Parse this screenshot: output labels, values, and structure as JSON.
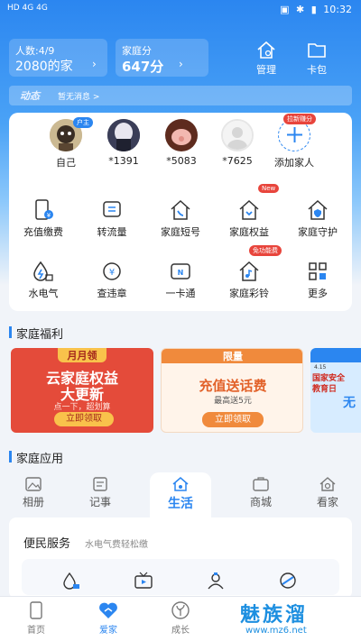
{
  "status_bar": {
    "left": "HD 4G 4G",
    "time": "10:32"
  },
  "header": {
    "members_card": {
      "title": "人数:4/9",
      "value": "2080的家"
    },
    "score_card": {
      "title": "家庭分",
      "value": "647分"
    },
    "manage_label": "管理",
    "wallet_label": "卡包"
  },
  "news": {
    "tag": "动态",
    "message": "暂无消息 >"
  },
  "members": [
    {
      "label": "自己",
      "badge": "户主"
    },
    {
      "label": "*1391"
    },
    {
      "label": "*5083"
    },
    {
      "label": "*7625"
    },
    {
      "label": "添加家人",
      "badge": "拉新赚分"
    }
  ],
  "grid": [
    {
      "label": "充值缴费",
      "icon": "phone-pay-icon"
    },
    {
      "label": "转流量",
      "icon": "data-transfer-icon"
    },
    {
      "label": "家庭短号",
      "icon": "home-phone-icon"
    },
    {
      "label": "家庭权益",
      "icon": "home-benefit-icon",
      "badge": "New"
    },
    {
      "label": "家庭守护",
      "icon": "home-shield-icon"
    },
    {
      "label": "水电气",
      "icon": "utilities-icon"
    },
    {
      "label": "查违章",
      "icon": "traffic-violation-icon"
    },
    {
      "label": "一卡通",
      "icon": "card-icon"
    },
    {
      "label": "家庭彩铃",
      "icon": "ringtone-icon",
      "badge": "免功能费"
    },
    {
      "label": "更多",
      "icon": "more-icon"
    }
  ],
  "welfare": {
    "title": "家庭福利",
    "banner1": {
      "tag": "月月领",
      "line1": "云家庭权益",
      "line2": "大更新",
      "sub": "点一下，超划算",
      "button": "立即领取"
    },
    "banner2": {
      "tag": "限量",
      "line1": "充值送话费",
      "sub": "最高送5元",
      "button": "立即领取"
    },
    "banner3": {
      "date": "4.15",
      "line1": "国家安全",
      "line2": "教育日",
      "line3": "无"
    }
  },
  "apps": {
    "title": "家庭应用",
    "tabs": [
      "相册",
      "记事",
      "生活",
      "商城",
      "看家"
    ],
    "active_tab": "生活"
  },
  "service": {
    "title": "便民服务",
    "subtitle": "水电气费轻松缴"
  },
  "bottom_nav": [
    {
      "label": "首页"
    },
    {
      "label": "爱家"
    },
    {
      "label": "成长"
    }
  ],
  "watermark": {
    "text": "魅族溜",
    "url": "www.mz6.net"
  },
  "colors": {
    "primary": "#2b86f0",
    "accent_red": "#e8453c",
    "banner1": "#e44b3a",
    "banner2": "#f08a3c"
  }
}
